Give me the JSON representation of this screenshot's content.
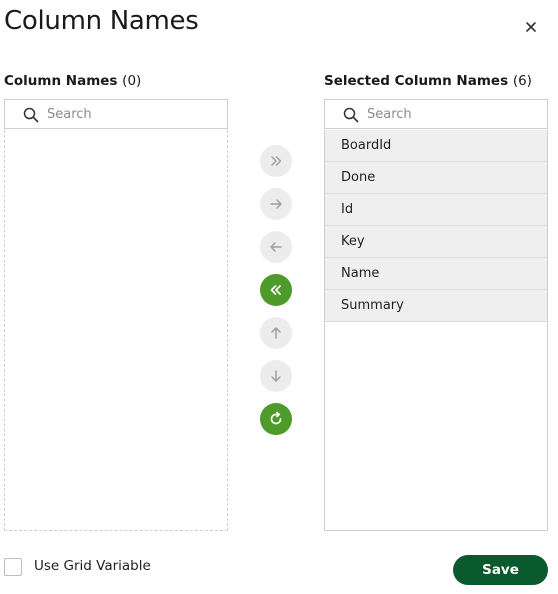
{
  "dialog": {
    "title": "Column Names"
  },
  "available": {
    "label": "Column Names",
    "count": "(0)",
    "search_placeholder": "Search",
    "items": []
  },
  "selected": {
    "label": "Selected Column Names",
    "count": "(6)",
    "search_placeholder": "Search",
    "items": [
      "BoardId",
      "Done",
      "Id",
      "Key",
      "Name",
      "Summary"
    ]
  },
  "controls": [
    {
      "name": "add-all-button",
      "icon": "double-chevron-right-icon",
      "active": false
    },
    {
      "name": "add-selected-button",
      "icon": "arrow-right-icon",
      "active": false
    },
    {
      "name": "remove-selected-button",
      "icon": "arrow-left-icon",
      "active": false
    },
    {
      "name": "remove-all-button",
      "icon": "double-chevron-left-icon",
      "active": true
    },
    {
      "name": "move-up-button",
      "icon": "arrow-up-icon",
      "active": false
    },
    {
      "name": "move-down-button",
      "icon": "arrow-down-icon",
      "active": false
    },
    {
      "name": "reset-button",
      "icon": "refresh-icon",
      "active": true
    }
  ],
  "footer": {
    "use_grid_variable_label": "Use Grid Variable",
    "save_label": "Save"
  },
  "colors": {
    "accent_green": "#4e9a2a",
    "save_green": "#0b5a2d",
    "inactive_grey": "#ececec",
    "icon_inactive": "#9e9e9e"
  }
}
